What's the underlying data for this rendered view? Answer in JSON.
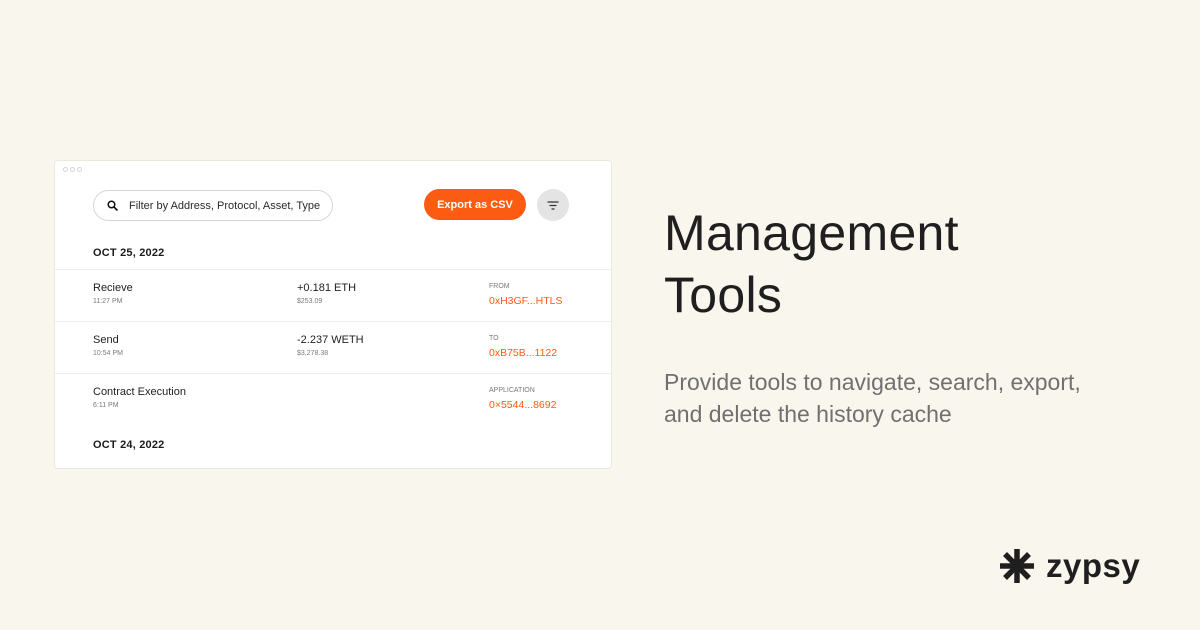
{
  "search": {
    "placeholder": "Filter by Address, Protocol, Asset, Type"
  },
  "toolbar": {
    "export_label": "Export as CSV"
  },
  "groups": [
    {
      "date": "OCT 25, 2022",
      "rows": [
        {
          "type": "Recieve",
          "time": "11:27 PM",
          "amount": "+0.181 ETH",
          "usd": "$253.09",
          "direction": "FROM",
          "address": "0xH3GF...HTLS"
        },
        {
          "type": "Send",
          "time": "10:54 PM",
          "amount": "-2.237 WETH",
          "usd": "$3,278.38",
          "direction": "TO",
          "address": "0xB75B...1122"
        },
        {
          "type": "Contract Execution",
          "time": "6:11 PM",
          "amount": "",
          "usd": "",
          "direction": "APPLICATION",
          "address": "0×5544...8692"
        }
      ]
    },
    {
      "date": "OCT 24, 2022",
      "rows": []
    }
  ],
  "hero": {
    "title_line1": "Management",
    "title_line2": "Tools",
    "subtitle_line1": "Provide tools to navigate, search, export,",
    "subtitle_line2": "and delete the history cache"
  },
  "brand": {
    "name": "zypsy",
    "icon": "asterisk-logo-icon"
  },
  "colors": {
    "accent": "#fc5c12",
    "background": "#f9f6ee",
    "card": "#ffffff",
    "muted": "#707070"
  },
  "icons": {
    "search": "search-icon",
    "filter": "filter-icon"
  }
}
